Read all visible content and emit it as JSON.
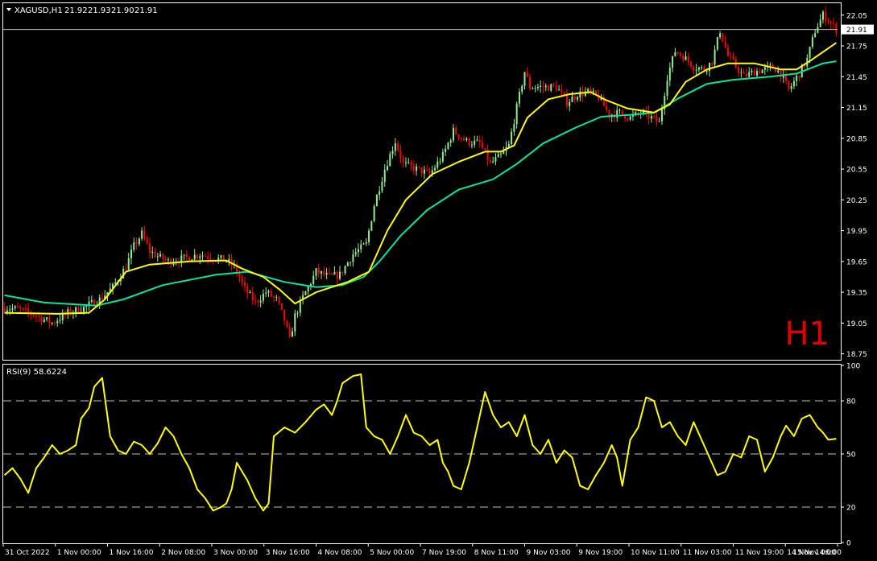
{
  "chart_data": [
    {
      "type": "candlestick",
      "header": {
        "symbol": "XAGUSD,H1",
        "ohlc": [
          "21.92",
          "21.93",
          "21.90",
          "21.91"
        ]
      },
      "last_price_label": "21.91",
      "last_price": 21.91,
      "watermark": "H1",
      "ylim": [
        18.7,
        22.15
      ],
      "y_ticks": [
        "22.05",
        "21.75",
        "21.45",
        "21.15",
        "20.85",
        "20.55",
        "20.25",
        "19.95",
        "19.65",
        "19.35",
        "19.05",
        "18.75"
      ],
      "x_tick_labels": [
        "31 Oct 2022",
        "1 Nov 00:00",
        "1 Nov 16:00",
        "2 Nov 08:00",
        "3 Nov 00:00",
        "3 Nov 16:00",
        "4 Nov 08:00",
        "5 Nov 00:00",
        "7 Nov 19:00",
        "8 Nov 11:00",
        "9 Nov 03:00",
        "9 Nov 19:00",
        "10 Nov 11:00",
        "11 Nov 03:00",
        "11 Nov 19:00",
        "14 Nov 14:00",
        "15 Nov 06:00"
      ],
      "close_path": [
        [
          0,
          19.2
        ],
        [
          6,
          19.18
        ],
        [
          12,
          19.12
        ],
        [
          18,
          19.05
        ],
        [
          24,
          19.15
        ],
        [
          30,
          19.2
        ],
        [
          36,
          19.28
        ],
        [
          41,
          19.4
        ],
        [
          46,
          19.6
        ],
        [
          49,
          19.8
        ],
        [
          52,
          19.92
        ],
        [
          55,
          19.75
        ],
        [
          58,
          19.7
        ],
        [
          62,
          19.65
        ],
        [
          68,
          19.68
        ],
        [
          74,
          19.72
        ],
        [
          80,
          19.68
        ],
        [
          84,
          19.66
        ],
        [
          87,
          19.6
        ],
        [
          91,
          19.38
        ],
        [
          95,
          19.25
        ],
        [
          99,
          19.35
        ],
        [
          103,
          19.28
        ],
        [
          106,
          19.08
        ],
        [
          108,
          18.88
        ],
        [
          110,
          19.12
        ],
        [
          113,
          19.3
        ],
        [
          118,
          19.55
        ],
        [
          123,
          19.5
        ],
        [
          127,
          19.52
        ],
        [
          132,
          19.72
        ],
        [
          137,
          19.82
        ],
        [
          140,
          20.2
        ],
        [
          144,
          20.55
        ],
        [
          148,
          20.82
        ],
        [
          151,
          20.6
        ],
        [
          156,
          20.55
        ],
        [
          161,
          20.5
        ],
        [
          166,
          20.68
        ],
        [
          170,
          20.92
        ],
        [
          175,
          20.82
        ],
        [
          180,
          20.8
        ],
        [
          184,
          20.6
        ],
        [
          188,
          20.68
        ],
        [
          191,
          20.78
        ],
        [
          194,
          21.15
        ],
        [
          197,
          21.5
        ],
        [
          199,
          21.35
        ],
        [
          204,
          21.35
        ],
        [
          209,
          21.35
        ],
        [
          213,
          21.2
        ],
        [
          217,
          21.28
        ],
        [
          221,
          21.3
        ],
        [
          225,
          21.25
        ],
        [
          229,
          21.08
        ],
        [
          233,
          21.1
        ],
        [
          237,
          21.05
        ],
        [
          241,
          21.1
        ],
        [
          245,
          21.05
        ],
        [
          248,
          21.0
        ],
        [
          251,
          21.45
        ],
        [
          254,
          21.7
        ],
        [
          257,
          21.65
        ],
        [
          261,
          21.55
        ],
        [
          265,
          21.52
        ],
        [
          268,
          21.6
        ],
        [
          271,
          21.9
        ],
        [
          274,
          21.65
        ],
        [
          277,
          21.55
        ],
        [
          280,
          21.45
        ],
        [
          284,
          21.5
        ],
        [
          288,
          21.52
        ],
        [
          291,
          21.55
        ],
        [
          294,
          21.48
        ],
        [
          297,
          21.32
        ],
        [
          301,
          21.48
        ],
        [
          304,
          21.62
        ],
        [
          307,
          21.9
        ],
        [
          310,
          22.05
        ],
        [
          312,
          22.0
        ],
        [
          315,
          21.91
        ]
      ],
      "ma_fast": [
        [
          0,
          19.15
        ],
        [
          20,
          19.14
        ],
        [
          32,
          19.15
        ],
        [
          38,
          19.28
        ],
        [
          46,
          19.55
        ],
        [
          55,
          19.62
        ],
        [
          70,
          19.65
        ],
        [
          84,
          19.66
        ],
        [
          90,
          19.58
        ],
        [
          98,
          19.5
        ],
        [
          104,
          19.38
        ],
        [
          110,
          19.24
        ],
        [
          118,
          19.35
        ],
        [
          130,
          19.45
        ],
        [
          138,
          19.55
        ],
        [
          145,
          19.95
        ],
        [
          152,
          20.25
        ],
        [
          162,
          20.5
        ],
        [
          172,
          20.62
        ],
        [
          182,
          20.72
        ],
        [
          188,
          20.72
        ],
        [
          193,
          20.78
        ],
        [
          198,
          21.05
        ],
        [
          206,
          21.23
        ],
        [
          214,
          21.28
        ],
        [
          222,
          21.3
        ],
        [
          228,
          21.22
        ],
        [
          236,
          21.14
        ],
        [
          246,
          21.1
        ],
        [
          252,
          21.18
        ],
        [
          258,
          21.4
        ],
        [
          266,
          21.52
        ],
        [
          274,
          21.58
        ],
        [
          284,
          21.58
        ],
        [
          294,
          21.52
        ],
        [
          300,
          21.52
        ],
        [
          306,
          21.62
        ],
        [
          315,
          21.78
        ]
      ],
      "ma_slow": [
        [
          0,
          19.32
        ],
        [
          15,
          19.25
        ],
        [
          35,
          19.22
        ],
        [
          45,
          19.28
        ],
        [
          60,
          19.42
        ],
        [
          80,
          19.52
        ],
        [
          92,
          19.55
        ],
        [
          106,
          19.45
        ],
        [
          118,
          19.4
        ],
        [
          128,
          19.42
        ],
        [
          136,
          19.5
        ],
        [
          142,
          19.65
        ],
        [
          150,
          19.9
        ],
        [
          160,
          20.15
        ],
        [
          172,
          20.35
        ],
        [
          185,
          20.45
        ],
        [
          194,
          20.6
        ],
        [
          204,
          20.8
        ],
        [
          216,
          20.95
        ],
        [
          226,
          21.06
        ],
        [
          238,
          21.08
        ],
        [
          246,
          21.1
        ],
        [
          256,
          21.25
        ],
        [
          266,
          21.38
        ],
        [
          276,
          21.42
        ],
        [
          290,
          21.45
        ],
        [
          300,
          21.48
        ],
        [
          310,
          21.58
        ],
        [
          315,
          21.6
        ]
      ]
    },
    {
      "type": "line",
      "label": "RSI(9) 58.6224",
      "ylim": [
        0,
        100
      ],
      "y_ticks": [
        "100",
        "80",
        "50",
        "20",
        "0"
      ],
      "levels": [
        80,
        50,
        20
      ],
      "rsi_path": [
        [
          0,
          38
        ],
        [
          3,
          42
        ],
        [
          6,
          36
        ],
        [
          9,
          28
        ],
        [
          12,
          42
        ],
        [
          15,
          48
        ],
        [
          18,
          55
        ],
        [
          21,
          50
        ],
        [
          24,
          52
        ],
        [
          27,
          55
        ],
        [
          29,
          70
        ],
        [
          32,
          76
        ],
        [
          34,
          88
        ],
        [
          37,
          93
        ],
        [
          40,
          60
        ],
        [
          43,
          52
        ],
        [
          46,
          50
        ],
        [
          49,
          57
        ],
        [
          52,
          55
        ],
        [
          55,
          50
        ],
        [
          58,
          56
        ],
        [
          61,
          65
        ],
        [
          64,
          60
        ],
        [
          67,
          50
        ],
        [
          70,
          42
        ],
        [
          73,
          30
        ],
        [
          76,
          25
        ],
        [
          79,
          18
        ],
        [
          82,
          20
        ],
        [
          84,
          22
        ],
        [
          86,
          30
        ],
        [
          88,
          45
        ],
        [
          90,
          40
        ],
        [
          92,
          35
        ],
        [
          95,
          25
        ],
        [
          98,
          18
        ],
        [
          100,
          22
        ],
        [
          102,
          60
        ],
        [
          106,
          65
        ],
        [
          110,
          62
        ],
        [
          114,
          68
        ],
        [
          118,
          75
        ],
        [
          121,
          78
        ],
        [
          124,
          72
        ],
        [
          126,
          80
        ],
        [
          128,
          90
        ],
        [
          132,
          94
        ],
        [
          135,
          95
        ],
        [
          137,
          65
        ],
        [
          140,
          60
        ],
        [
          143,
          58
        ],
        [
          146,
          50
        ],
        [
          149,
          60
        ],
        [
          152,
          72
        ],
        [
          155,
          62
        ],
        [
          158,
          60
        ],
        [
          161,
          55
        ],
        [
          164,
          58
        ],
        [
          166,
          45
        ],
        [
          168,
          40
        ],
        [
          170,
          32
        ],
        [
          173,
          30
        ],
        [
          176,
          45
        ],
        [
          179,
          65
        ],
        [
          182,
          85
        ],
        [
          185,
          72
        ],
        [
          188,
          65
        ],
        [
          191,
          68
        ],
        [
          194,
          60
        ],
        [
          197,
          72
        ],
        [
          200,
          55
        ],
        [
          203,
          50
        ],
        [
          206,
          58
        ],
        [
          209,
          45
        ],
        [
          212,
          52
        ],
        [
          215,
          48
        ],
        [
          218,
          32
        ],
        [
          221,
          30
        ],
        [
          224,
          38
        ],
        [
          227,
          45
        ],
        [
          230,
          55
        ],
        [
          232,
          48
        ],
        [
          234,
          32
        ],
        [
          237,
          58
        ],
        [
          240,
          65
        ],
        [
          243,
          82
        ],
        [
          246,
          80
        ],
        [
          249,
          65
        ],
        [
          252,
          68
        ],
        [
          255,
          60
        ],
        [
          258,
          55
        ],
        [
          261,
          68
        ],
        [
          264,
          58
        ],
        [
          267,
          48
        ],
        [
          270,
          38
        ],
        [
          273,
          40
        ],
        [
          276,
          50
        ],
        [
          279,
          48
        ],
        [
          282,
          60
        ],
        [
          285,
          58
        ],
        [
          288,
          40
        ],
        [
          291,
          48
        ],
        [
          294,
          60
        ],
        [
          296,
          66
        ],
        [
          299,
          60
        ],
        [
          302,
          70
        ],
        [
          305,
          72
        ],
        [
          308,
          65
        ],
        [
          310,
          62
        ],
        [
          312,
          58
        ],
        [
          315,
          58.6
        ]
      ]
    }
  ],
  "colors": {
    "background": "#000000",
    "bull_candle": "#90ee90",
    "bear_candle": "#ff0000",
    "ma_fast": "#ffff00",
    "ma_slow": "#00e5a0",
    "rsi": "#ffff00",
    "grid_dash": "#bfbfbf",
    "frame": "#ffffff",
    "watermark": "#ff0000",
    "price_line": "#c0c0c0"
  }
}
